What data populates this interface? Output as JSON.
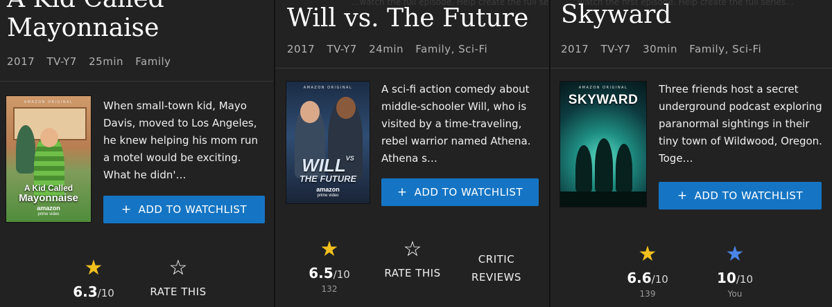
{
  "colors": {
    "background": "#222222",
    "accent": "#1575c4",
    "star_gold": "#f2c01e",
    "star_user": "#4a86e8"
  },
  "cards": [
    {
      "title_line1": "A Kid Called",
      "title_line2": "Mayonnaise",
      "year": "2017",
      "rating": "TV-Y7",
      "duration": "25min",
      "genres": "Family",
      "poster": {
        "top_text": "AMAZON ORIGINAL",
        "title_line1": "A Kid Called",
        "title_line2": "Mayonnaise",
        "brand": "amazon",
        "brand_sub": "prime video"
      },
      "description": "When small-town kid, Mayo Davis, moved to Los Angeles, he knew helping his mom run a motel would be exciting. What he didn'…",
      "watchlist_label": "ADD TO WATCHLIST",
      "imdb_score": "6.3",
      "score_out_of": "/10",
      "rate_label": "RATE THIS"
    },
    {
      "ghost_text": "...watch the full episode. Help create the full series...",
      "title": "Will vs. The Future",
      "year": "2017",
      "rating": "TV-Y7",
      "duration": "24min",
      "genres": "Family, Sci-Fi",
      "poster": {
        "top_text": "AMAZON ORIGINAL",
        "title_line1": "WILL",
        "title_vs": "VS",
        "title_line2": "THE FUTURE",
        "brand": "amazon",
        "brand_sub": "prime video"
      },
      "description": "A sci-fi action comedy about middle-schooler Will, who is visited by a time-traveling, rebel warrior named Athena. Athena s…",
      "watchlist_label": "ADD TO WATCHLIST",
      "imdb_score": "6.5",
      "score_out_of": "/10",
      "votes": "132",
      "rate_label": "RATE THIS",
      "critic_line1": "CRITIC",
      "critic_line2": "REVIEWS"
    },
    {
      "ghost_text": "...watch the first episode. Help create the full series...",
      "title": "Skyward",
      "year": "2017",
      "rating": "TV-Y7",
      "duration": "30min",
      "genres": "Family, Sci-Fi",
      "poster": {
        "top_text": "AMAZON ORIGINAL",
        "title_line1": "SKYWARD"
      },
      "description": "Three friends host a secret underground podcast exploring paranormal sightings in their tiny town of Wildwood, Oregon. Toge…",
      "watchlist_label": "ADD TO WATCHLIST",
      "imdb_score": "6.6",
      "score_out_of": "/10",
      "votes": "139",
      "user_score": "10",
      "user_out_of": "/10",
      "user_label": "You"
    }
  ]
}
